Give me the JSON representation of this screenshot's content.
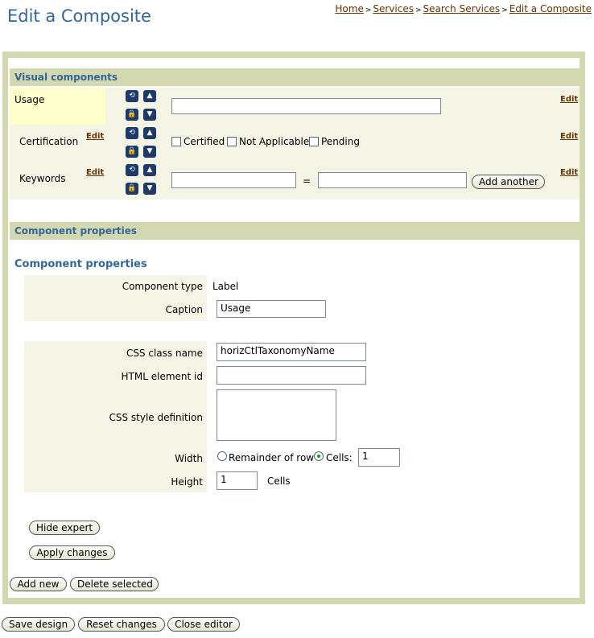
{
  "page": {
    "title": "Edit a Composite"
  },
  "breadcrumb": {
    "items": [
      "Home",
      "Services",
      "Search Services",
      "Edit a Composite"
    ],
    "separator": ">"
  },
  "visual_components": {
    "section_label": "Visual components",
    "rows": [
      {
        "label": "Usage",
        "edit": "Edit",
        "row_edit": null
      },
      {
        "label": "Certification",
        "edit": "Edit",
        "row_edit": "Edit",
        "options": [
          "Certified",
          "Not Applicable",
          "Pending"
        ]
      },
      {
        "label": "Keywords",
        "edit": "Edit",
        "row_edit": "Edit",
        "equals": "=",
        "add_another": "Add another"
      }
    ]
  },
  "component_properties": {
    "section_label": "Component properties",
    "title": "Component properties",
    "component_type_label": "Component type",
    "component_type_value": "Label",
    "caption_label": "Caption",
    "caption_value": "Usage",
    "css_class_label": "CSS class name",
    "css_class_value": "horizCtlTaxonomyName",
    "html_id_label": "HTML element id",
    "html_id_value": "",
    "css_style_label": "CSS style definition",
    "css_style_value": "",
    "width_label": "Width",
    "width_opt1": "Remainder of row",
    "width_opt2": "Cells:",
    "width_cells_value": "1",
    "height_label": "Height",
    "height_value": "1",
    "height_unit": "Cells",
    "hide_expert": "Hide expert",
    "apply_changes": "Apply changes"
  },
  "actions": {
    "add_new": "Add new",
    "delete_selected": "Delete selected"
  },
  "footer": {
    "save_design": "Save design",
    "reset_changes": "Reset changes",
    "close_editor": "Close editor"
  },
  "colors": {
    "accent": "#336699",
    "panel": "#d4d8b0",
    "row_bg": "#f5f5e6",
    "selected_row": "#ffffcc",
    "icon_btn": "#1d3a6b",
    "link": "#663300"
  }
}
